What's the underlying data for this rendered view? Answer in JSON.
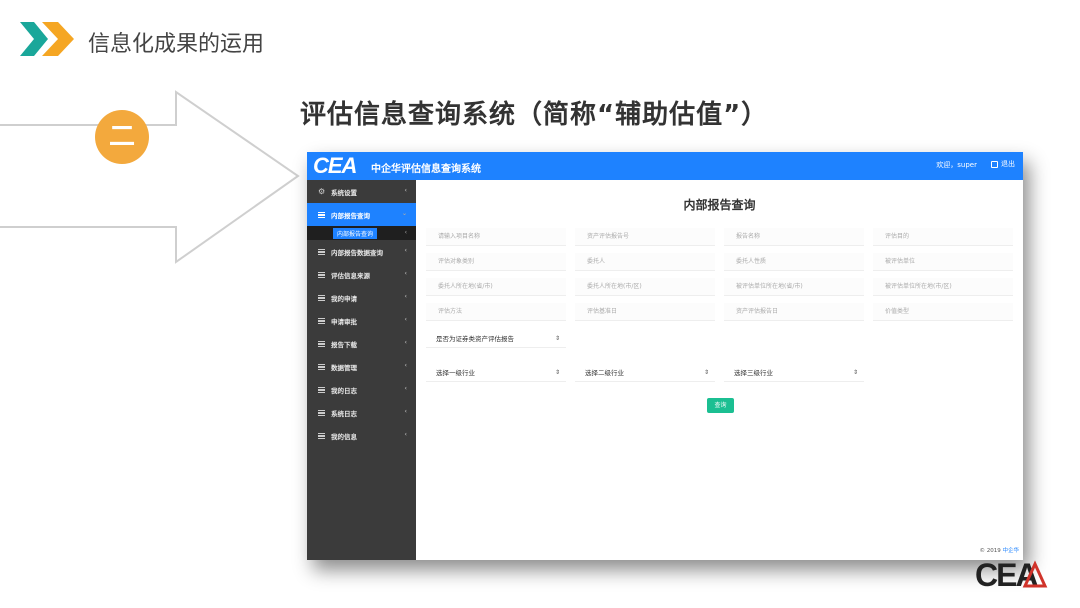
{
  "slide": {
    "heading": "信息化成果的运用",
    "section_number": "二",
    "system_title": "评估信息查询系统（简称“辅助估值”）"
  },
  "app": {
    "logo_text": "CEA",
    "name": "中企华评估信息查询系统",
    "greeting": "欢迎，super",
    "logout_label": "退出",
    "sidebar": {
      "items": [
        {
          "label": "系统设置",
          "icon": "gear-icon"
        },
        {
          "label": "内部报告查询",
          "icon": "list-icon",
          "active": true
        },
        {
          "label": "内部报告数据查询",
          "icon": "list-icon"
        },
        {
          "label": "评估信息来源",
          "icon": "list-icon"
        },
        {
          "label": "我的申请",
          "icon": "list-icon"
        },
        {
          "label": "申请审批",
          "icon": "list-icon"
        },
        {
          "label": "报告下载",
          "icon": "list-icon"
        },
        {
          "label": "数据管理",
          "icon": "list-icon"
        },
        {
          "label": "我的日志",
          "icon": "list-icon"
        },
        {
          "label": "系统日志",
          "icon": "list-icon"
        },
        {
          "label": "我的信息",
          "icon": "list-icon"
        }
      ],
      "sub_item": "内部报告查询"
    },
    "main": {
      "title": "内部报告查询",
      "fields": [
        "请输入项目名称",
        "资产评估报告号",
        "报告名称",
        "评估目的",
        "评估对象类别",
        "委托人",
        "委托人性质",
        "被评估单位",
        "委托人所在地(省/市)",
        "委托人所在地(市/区)",
        "被评估单位所在地(省/市)",
        "被评估单位所在地(市/区)",
        "评估方法",
        "评估基准日",
        "资产评估报告日",
        "价值类型"
      ],
      "securities_select": "是否为证券类资产评估报告",
      "industry_selects": [
        "选择一级行业",
        "选择二级行业",
        "选择三级行业"
      ],
      "query_button": "查询",
      "footer_copyright": "© 2019",
      "footer_brand": "中企华"
    }
  },
  "corner_logo_text": "CEA",
  "colors": {
    "header_blue": "#1e82ff",
    "sidebar_dark": "#3b3b3b",
    "badge_orange": "#f3a93d",
    "query_green": "#1bbf92",
    "chevron_teal": "#1aa79a",
    "chevron_orange": "#f5a623"
  }
}
